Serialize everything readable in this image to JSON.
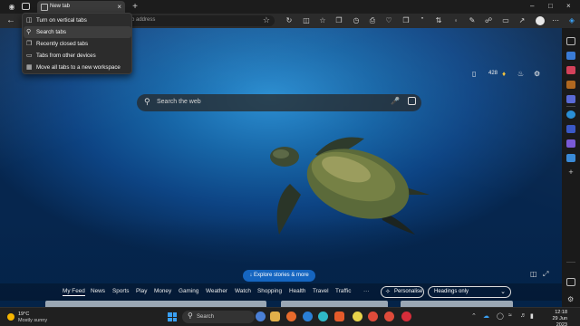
{
  "browser": {
    "tab_title": "New tab",
    "address_placeholder": "b address"
  },
  "tab_menu": {
    "items": [
      {
        "label": "Turn on vertical tabs",
        "icon": "vertical-tabs-icon"
      },
      {
        "label": "Search tabs",
        "icon": "search-icon"
      },
      {
        "label": "Recently closed tabs",
        "icon": "recent-tabs-icon"
      },
      {
        "label": "Tabs from other devices",
        "icon": "devices-icon"
      },
      {
        "label": "Move all tabs to a new workspace",
        "icon": "workspace-icon"
      }
    ],
    "hovered_index": 1
  },
  "newtab": {
    "search_placeholder": "Search the web",
    "rewards_points": "428",
    "explore_label": "Explore stories & more",
    "feed_tabs": [
      "My Feed",
      "News",
      "Sports",
      "Play",
      "Money",
      "Gaming",
      "Weather",
      "Watch",
      "Shopping",
      "Health",
      "Travel",
      "Traffic"
    ],
    "more_label": "···",
    "personalise_label": "Personalise",
    "layout_select": "Headings only"
  },
  "taskbar": {
    "temperature": "19°C",
    "condition": "Mostly sunny",
    "search_label": "Search",
    "time": "12:18",
    "date": "29 Jun 2023",
    "language": "ENG"
  },
  "colors": {
    "accent": "#1565c0",
    "sea_light": "#2c8fd2",
    "sea_dark": "#06264e",
    "windows_blue": "#3aa0f3"
  }
}
